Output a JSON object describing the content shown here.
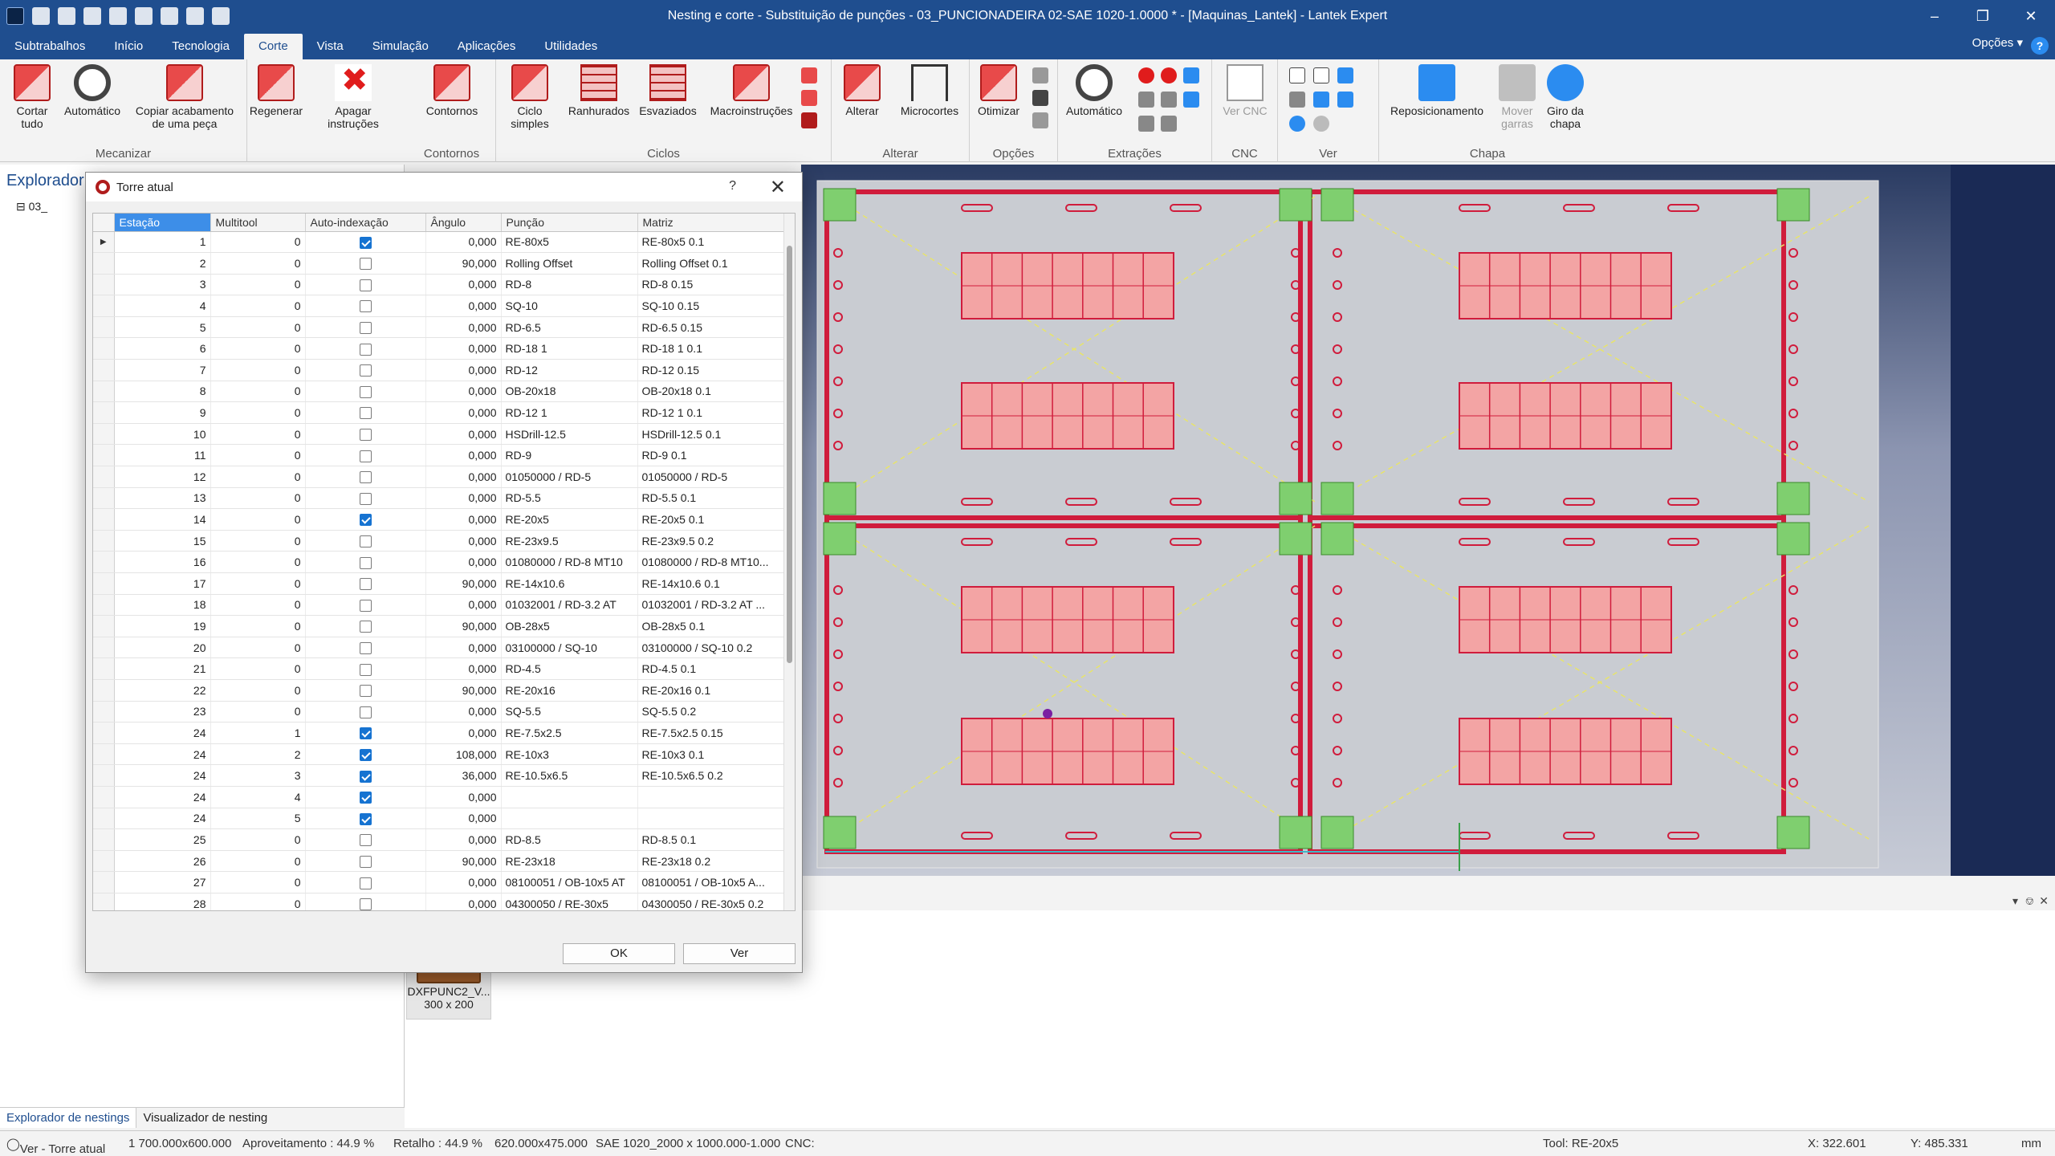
{
  "window": {
    "title": "Nesting e corte - Substituição de punções - 03_PUNCIONADEIRA 02-SAE 1020-1.0000 * - [Maquinas_Lantek] - Lantek Expert"
  },
  "menu": {
    "tabs": [
      "Subtrabalhos",
      "Início",
      "Tecnologia",
      "Corte",
      "Vista",
      "Simulação",
      "Aplicações",
      "Utilidades"
    ],
    "active_tab": "Corte",
    "options_label": "Opções",
    "help_label": "?"
  },
  "ribbon": {
    "groups": [
      {
        "label": "Mecanizar",
        "buttons": [
          "Cortar tudo",
          "Automático",
          "Copiar acabamento de uma peça",
          "Regenerar",
          "Apagar instruções"
        ]
      },
      {
        "label": "Contornos",
        "buttons": [
          "Contornos"
        ]
      },
      {
        "label": "Ciclos",
        "buttons": [
          "Ciclo simples",
          "Ranhurados",
          "Esvaziados",
          "Macroinstruções"
        ]
      },
      {
        "label": "Alterar",
        "buttons": [
          "Alterar",
          "Microcortes"
        ]
      },
      {
        "label": "Opções",
        "buttons": [
          "Otimizar"
        ]
      },
      {
        "label": "Extrações",
        "buttons": [
          "Automático"
        ]
      },
      {
        "label": "CNC",
        "buttons": [
          "Ver CNC"
        ]
      },
      {
        "label": "Ver",
        "buttons": []
      },
      {
        "label": "Chapa",
        "buttons": [
          "Reposicionamento",
          "Mover garras",
          "Giro da chapa"
        ]
      }
    ]
  },
  "explorer": {
    "title": "Explorador",
    "tree_item": "03_",
    "bottom_tabs": [
      "Explorador de nestings",
      "Visualizador de nesting"
    ]
  },
  "thumbnail": {
    "name": "DXFPUNC2_V...",
    "size": "300 x 200"
  },
  "dialog": {
    "title": "Torre atual",
    "help": "?",
    "columns": [
      "Estação",
      "Multitool",
      "Auto-indexação",
      "Ângulo",
      "Punção",
      "Matriz"
    ],
    "rows": [
      {
        "station": "1",
        "multitool": "0",
        "auto": true,
        "angle": "0,000",
        "punch": "RE-80x5",
        "die": "RE-80x5 0.1"
      },
      {
        "station": "2",
        "multitool": "0",
        "auto": false,
        "angle": "90,000",
        "punch": "Rolling Offset",
        "die": "Rolling Offset 0.1"
      },
      {
        "station": "3",
        "multitool": "0",
        "auto": false,
        "angle": "0,000",
        "punch": "RD-8",
        "die": "RD-8 0.15"
      },
      {
        "station": "4",
        "multitool": "0",
        "auto": false,
        "angle": "0,000",
        "punch": "SQ-10",
        "die": "SQ-10 0.15"
      },
      {
        "station": "5",
        "multitool": "0",
        "auto": false,
        "angle": "0,000",
        "punch": "RD-6.5",
        "die": "RD-6.5 0.15"
      },
      {
        "station": "6",
        "multitool": "0",
        "auto": false,
        "angle": "0,000",
        "punch": "RD-18 1",
        "die": "RD-18 1 0.1"
      },
      {
        "station": "7",
        "multitool": "0",
        "auto": false,
        "angle": "0,000",
        "punch": "RD-12",
        "die": "RD-12 0.15"
      },
      {
        "station": "8",
        "multitool": "0",
        "auto": false,
        "angle": "0,000",
        "punch": "OB-20x18",
        "die": "OB-20x18 0.1"
      },
      {
        "station": "9",
        "multitool": "0",
        "auto": false,
        "angle": "0,000",
        "punch": "RD-12 1",
        "die": "RD-12 1 0.1"
      },
      {
        "station": "10",
        "multitool": "0",
        "auto": false,
        "angle": "0,000",
        "punch": "HSDrill-12.5",
        "die": "HSDrill-12.5 0.1"
      },
      {
        "station": "11",
        "multitool": "0",
        "auto": false,
        "angle": "0,000",
        "punch": "RD-9",
        "die": "RD-9 0.1"
      },
      {
        "station": "12",
        "multitool": "0",
        "auto": false,
        "angle": "0,000",
        "punch": "01050000 / RD-5",
        "die": "01050000 / RD-5"
      },
      {
        "station": "13",
        "multitool": "0",
        "auto": false,
        "angle": "0,000",
        "punch": "RD-5.5",
        "die": "RD-5.5 0.1"
      },
      {
        "station": "14",
        "multitool": "0",
        "auto": true,
        "angle": "0,000",
        "punch": "RE-20x5",
        "die": "RE-20x5 0.1"
      },
      {
        "station": "15",
        "multitool": "0",
        "auto": false,
        "angle": "0,000",
        "punch": "RE-23x9.5",
        "die": "RE-23x9.5 0.2"
      },
      {
        "station": "16",
        "multitool": "0",
        "auto": false,
        "angle": "0,000",
        "punch": "01080000 / RD-8 MT10",
        "die": "01080000 / RD-8 MT10..."
      },
      {
        "station": "17",
        "multitool": "0",
        "auto": false,
        "angle": "90,000",
        "punch": "RE-14x10.6",
        "die": "RE-14x10.6 0.1"
      },
      {
        "station": "18",
        "multitool": "0",
        "auto": false,
        "angle": "0,000",
        "punch": "01032001 / RD-3.2 AT",
        "die": "01032001 / RD-3.2 AT ..."
      },
      {
        "station": "19",
        "multitool": "0",
        "auto": false,
        "angle": "90,000",
        "punch": "OB-28x5",
        "die": "OB-28x5 0.1"
      },
      {
        "station": "20",
        "multitool": "0",
        "auto": false,
        "angle": "0,000",
        "punch": "03100000 / SQ-10",
        "die": "03100000 / SQ-10 0.2"
      },
      {
        "station": "21",
        "multitool": "0",
        "auto": false,
        "angle": "0,000",
        "punch": "RD-4.5",
        "die": "RD-4.5 0.1"
      },
      {
        "station": "22",
        "multitool": "0",
        "auto": false,
        "angle": "90,000",
        "punch": "RE-20x16",
        "die": "RE-20x16 0.1"
      },
      {
        "station": "23",
        "multitool": "0",
        "auto": false,
        "angle": "0,000",
        "punch": "SQ-5.5",
        "die": "SQ-5.5 0.2"
      },
      {
        "station": "24",
        "multitool": "1",
        "auto": true,
        "angle": "0,000",
        "punch": "RE-7.5x2.5",
        "die": "RE-7.5x2.5 0.15"
      },
      {
        "station": "24",
        "multitool": "2",
        "auto": true,
        "angle": "108,000",
        "punch": "RE-10x3",
        "die": "RE-10x3 0.1"
      },
      {
        "station": "24",
        "multitool": "3",
        "auto": true,
        "angle": "36,000",
        "punch": "RE-10.5x6.5",
        "die": "RE-10.5x6.5 0.2"
      },
      {
        "station": "24",
        "multitool": "4",
        "auto": true,
        "angle": "0,000",
        "punch": "",
        "die": ""
      },
      {
        "station": "24",
        "multitool": "5",
        "auto": true,
        "angle": "0,000",
        "punch": "",
        "die": ""
      },
      {
        "station": "25",
        "multitool": "0",
        "auto": false,
        "angle": "0,000",
        "punch": "RD-8.5",
        "die": "RD-8.5 0.1"
      },
      {
        "station": "26",
        "multitool": "0",
        "auto": false,
        "angle": "90,000",
        "punch": "RE-23x18",
        "die": "RE-23x18 0.2"
      },
      {
        "station": "27",
        "multitool": "0",
        "auto": false,
        "angle": "0,000",
        "punch": "08100051 / OB-10x5 AT",
        "die": "08100051 / OB-10x5 A..."
      },
      {
        "station": "28",
        "multitool": "0",
        "auto": false,
        "angle": "0,000",
        "punch": "04300050 / RE-30x5",
        "die": "04300050 / RE-30x5 0.2"
      }
    ],
    "ok_label": "OK",
    "view_label": "Ver"
  },
  "statusbar": {
    "mode": "Ver - Torre atual",
    "sheet": "1 700.000x600.000",
    "usage": "Aproveitamento : 44.9 %",
    "remnant": "Retalho : 44.9 %",
    "dims": "620.000x475.000",
    "material": "SAE 1020_2000 x 1000.000-1.000",
    "cnc": "CNC:",
    "tool": "Tool: RE-20x5",
    "x": "X: 322.601",
    "y": "Y: 485.331",
    "units": "mm"
  },
  "colors": {
    "titlebar": "#1f4e8f",
    "part_fill": "#f3a4a4",
    "part_stroke": "#d01c3c",
    "clamp_green": "#7fcf6f"
  }
}
